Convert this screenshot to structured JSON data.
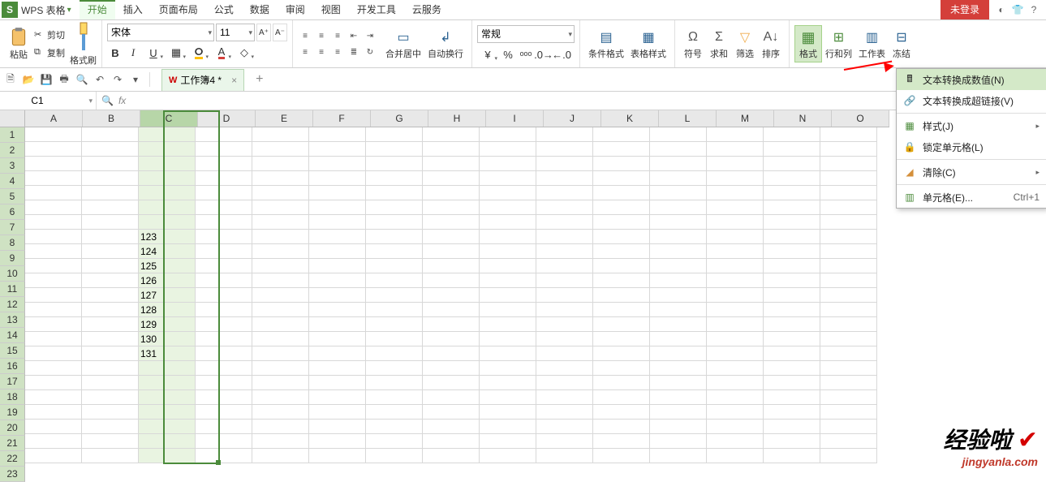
{
  "app": {
    "logo": "S",
    "title": "WPS 表格"
  },
  "menu_tabs": [
    "开始",
    "插入",
    "页面布局",
    "公式",
    "数据",
    "审阅",
    "视图",
    "开发工具",
    "云服务"
  ],
  "login_status": "未登录",
  "ribbon": {
    "paste": "粘贴",
    "cut": "剪切",
    "copy": "复制",
    "format_painter": "格式刷",
    "font_name": "宋体",
    "font_size": "11",
    "merge_center": "合并居中",
    "auto_wrap": "自动换行",
    "number_format": "常规",
    "cond_format": "条件格式",
    "table_style": "表格样式",
    "symbols": "符号",
    "sum": "求和",
    "filter": "筛选",
    "sort": "排序",
    "format": "格式",
    "row_col": "行和列",
    "worksheet": "工作表",
    "freeze": "冻结"
  },
  "file_tab": "工作簿4 *",
  "name_box": "C1",
  "columns": [
    "A",
    "B",
    "C",
    "D",
    "E",
    "F",
    "G",
    "H",
    "I",
    "J",
    "K",
    "L",
    "M",
    "N",
    "O"
  ],
  "rows_count": 23,
  "cell_data": {
    "8": "123",
    "9": "124",
    "10": "125",
    "11": "126",
    "12": "127",
    "13": "128",
    "14": "129",
    "15": "130",
    "16": "131"
  },
  "context_menu": {
    "text_to_number": "文本转换成数值(N)",
    "text_to_link": "文本转换成超链接(V)",
    "style": "样式(J)",
    "lock_cell": "锁定单元格(L)",
    "clear": "清除(C)",
    "cells": "单元格(E)...",
    "cells_shortcut": "Ctrl+1"
  },
  "watermark": {
    "main": "经验啦",
    "url": "jingyanla.com"
  }
}
